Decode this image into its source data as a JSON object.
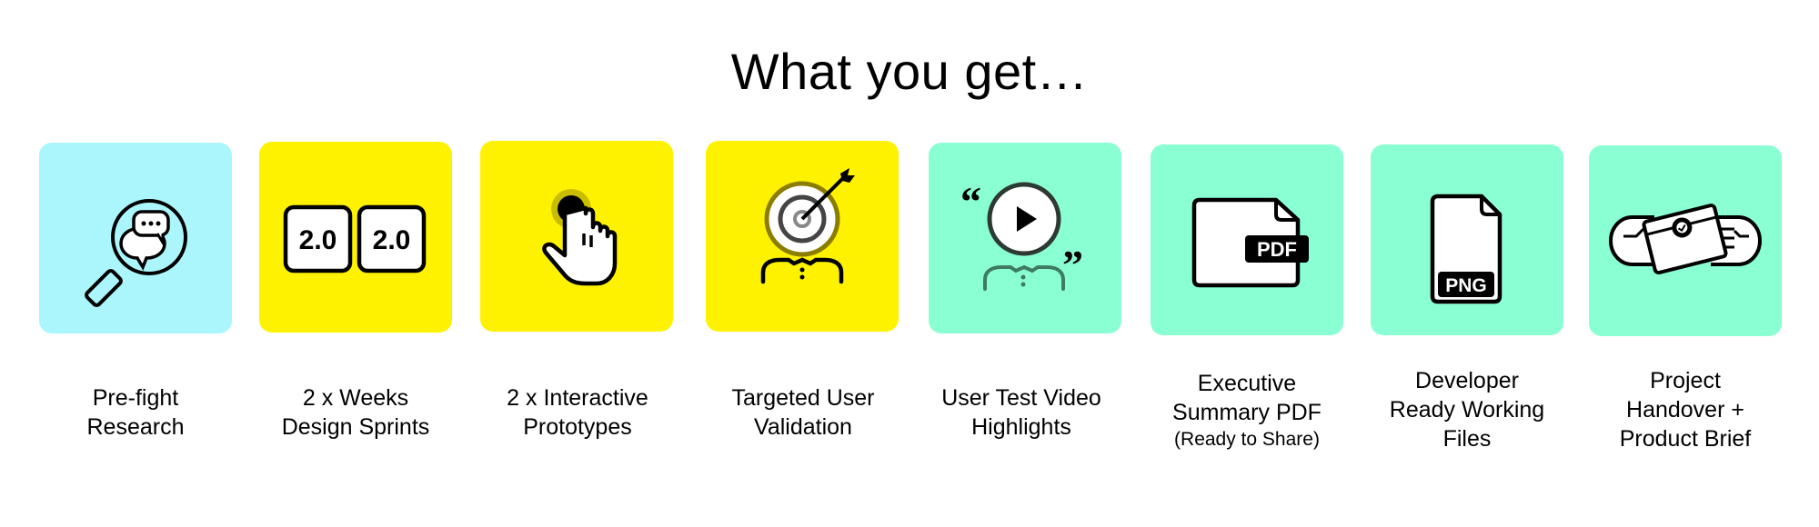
{
  "page": {
    "title": "What you get…"
  },
  "colors": {
    "cyan": "#aaf6fc",
    "yellow": "#fff200",
    "mint": "#8bffd4"
  },
  "cards": [
    {
      "icon": "magnifier-chat-icon",
      "color": "cyan",
      "label_lines": [
        "Pre-fight",
        "Research"
      ]
    },
    {
      "icon": "version-badges-icon",
      "color": "yellow",
      "badge_text": "2.0",
      "label_lines": [
        "2 x Weeks",
        "Design Sprints"
      ]
    },
    {
      "icon": "finger-tap-icon",
      "color": "yellow",
      "label_lines": [
        "2 x Interactive",
        "Prototypes"
      ]
    },
    {
      "icon": "target-user-icon",
      "color": "yellow",
      "label_lines": [
        "Targeted User",
        "Validation"
      ]
    },
    {
      "icon": "video-testimonial-icon",
      "color": "mint",
      "label_lines": [
        "User Test Video",
        "Highlights"
      ]
    },
    {
      "icon": "pdf-file-icon",
      "color": "mint",
      "file_tag": "PDF",
      "label_lines": [
        "Executive",
        "Summary PDF"
      ],
      "label_sub": "(Ready to Share)"
    },
    {
      "icon": "png-file-icon",
      "color": "mint",
      "file_tag": "PNG",
      "label_lines": [
        "Developer",
        "Ready Working",
        "Files"
      ]
    },
    {
      "icon": "handover-certificate-icon",
      "color": "mint",
      "label_lines": [
        "Project",
        "Handover +",
        "Product Brief"
      ]
    }
  ]
}
